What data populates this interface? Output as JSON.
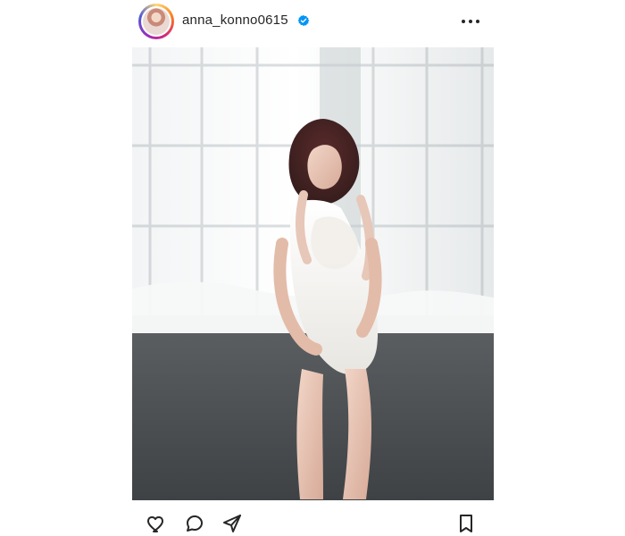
{
  "post": {
    "username": "anna_konno0615",
    "verified": true,
    "avatar": {
      "icon": "profile-avatar"
    },
    "menu": {
      "icon": "more-horizontal-icon"
    },
    "photo": {
      "alt_kind": "portrait-photo"
    },
    "actions": {
      "like_icon": "heart-icon",
      "comment_icon": "comment-icon",
      "share_icon": "send-icon",
      "save_icon": "bookmark-icon"
    }
  },
  "colors": {
    "text": "#262626",
    "verified": "#0095f6",
    "background": "#ffffff"
  }
}
